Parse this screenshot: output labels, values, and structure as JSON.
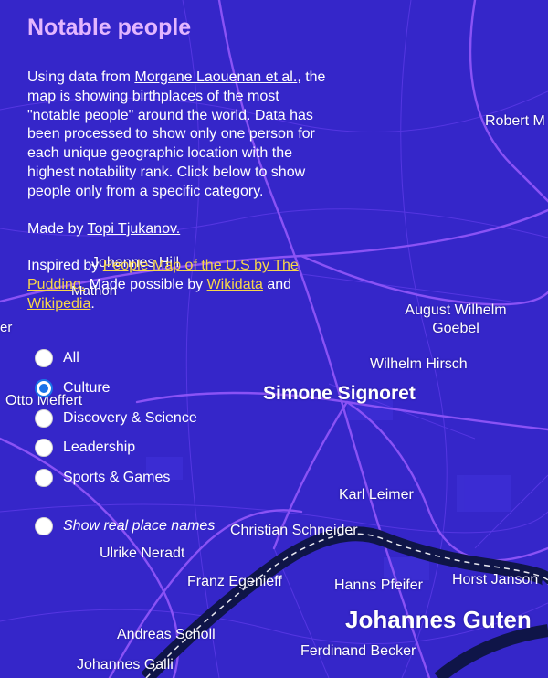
{
  "panel": {
    "title": "Notable people",
    "desc_pre": "Using data from ",
    "desc_link": "Morgane Laouenan et al.",
    "desc_post": ", the map is showing birthplaces of the most \"notable people\" around the world. Data has been processed to show only one person for each unique geographic location with the highest notability rank. Click below to show people only from a specific category.",
    "made_pre": "Made by ",
    "made_link": "Topi Tjukanov.",
    "inspired_pre": "Inspired by ",
    "inspired_link": "People Map of the U.S by The Pudding.",
    "inspired_mid": " Made possible by ",
    "wikidata_link": "Wikidata",
    "inspired_and": " and ",
    "wikipedia_link": "Wikipedia",
    "inspired_end": "."
  },
  "categories": [
    {
      "label": "All",
      "checked": false
    },
    {
      "label": "Culture",
      "checked": true
    },
    {
      "label": "Discovery & Science",
      "checked": false
    },
    {
      "label": "Leadership",
      "checked": false
    },
    {
      "label": "Sports & Games",
      "checked": false
    }
  ],
  "real_names_option": {
    "label": "Show real place names",
    "checked": false
  },
  "map_labels": {
    "robert": "Robert M",
    "johannes_hill": "Johannes Hill",
    "mathon": "Mathon",
    "august_wilhelm_goebel": "August Wilhelm\nGoebel",
    "er": "er",
    "wilhelm_hirsch": "Wilhelm Hirsch",
    "otto_meffert": "Otto Meffert",
    "simone_signoret": "Simone Signoret",
    "karl_leimer": "Karl Leimer",
    "christian_schneider": "Christian Schneider",
    "ulrike_neradt": "Ulrike Neradt",
    "franz_egenieff": "Franz Egenieff",
    "hanns_pfeifer": "Hanns Pfeifer",
    "horst_janson": "Horst Janson",
    "johannes_gutenberg": "Johannes Guten",
    "andreas_scholl": "Andreas Scholl",
    "ferdinand_becker": "Ferdinand Becker",
    "johannes_galli": "Johannes Galli"
  },
  "colors": {
    "background": "#3526c9",
    "road": "#8a52f5",
    "water": "#0f1548",
    "title": "#e3b6ff",
    "link_accent": "#f7d64a",
    "radio_selected": "#1a73e8"
  }
}
